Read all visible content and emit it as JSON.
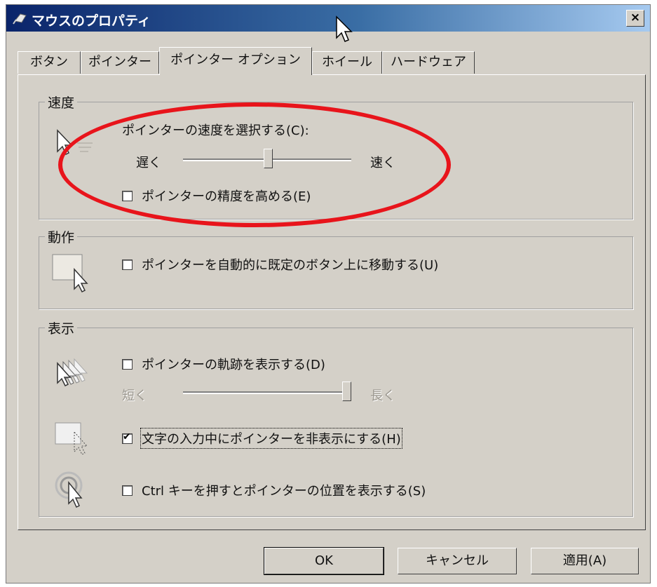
{
  "window": {
    "title": "マウスのプロパティ",
    "close_label": "×"
  },
  "tabs": [
    {
      "label": "ボタン",
      "active": false
    },
    {
      "label": "ポインター",
      "active": false
    },
    {
      "label": "ポインター オプション",
      "active": true
    },
    {
      "label": "ホイール",
      "active": false
    },
    {
      "label": "ハードウェア",
      "active": false
    }
  ],
  "speed_group": {
    "title": "速度",
    "prompt": "ポインターの速度を選択する(C):",
    "slow_label": "遅く",
    "fast_label": "速く",
    "slider_value": 0.5,
    "precision_label": "ポインターの精度を高める(E)",
    "precision_checked": false
  },
  "motion_group": {
    "title": "動作",
    "snap_label": "ポインターを自動的に既定のボタン上に移動する(U)",
    "snap_checked": false
  },
  "display_group": {
    "title": "表示",
    "trails_label": "ポインターの軌跡を表示する(D)",
    "trails_checked": false,
    "short_label": "短く",
    "long_label": "長く",
    "trails_slider_value": 1.0,
    "hide_label": "文字の入力中にポインターを非表示にする(H)",
    "hide_checked": true,
    "ctrl_label": "Ctrl キーを押すとポインターの位置を表示する(S)",
    "ctrl_checked": false
  },
  "buttons": {
    "ok": "OK",
    "cancel": "キャンセル",
    "apply": "適用(A)"
  },
  "colors": {
    "highlight_oval": "#e8141b",
    "dialog_bg": "#d4d0c8",
    "titlebar_start": "#0a246a"
  }
}
